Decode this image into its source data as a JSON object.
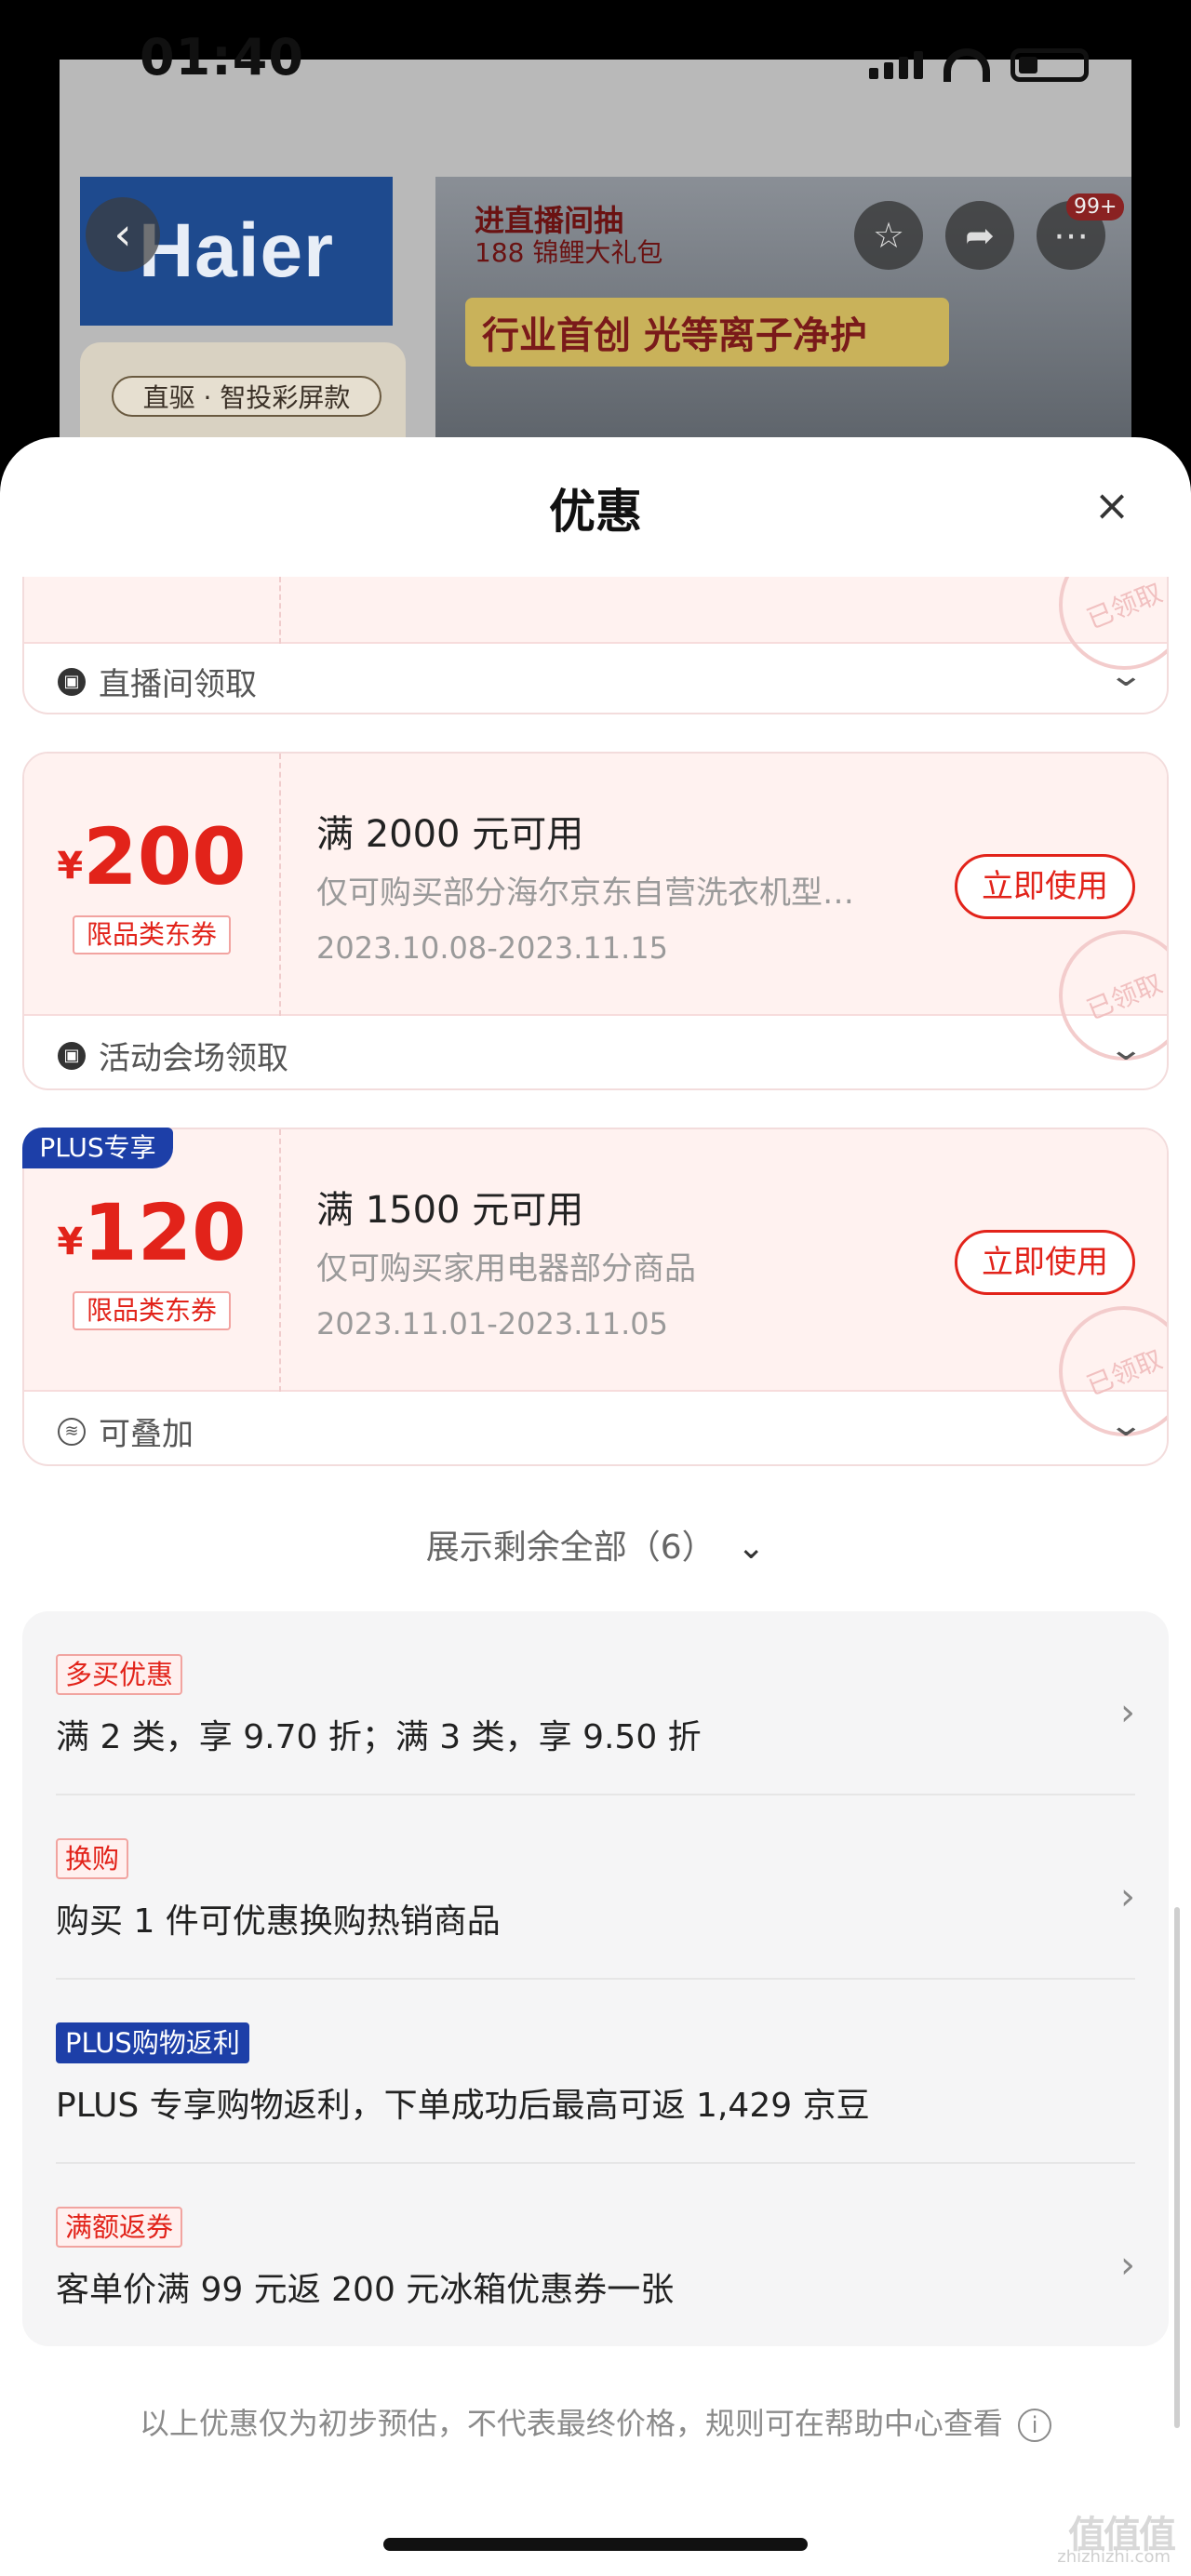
{
  "status_bar": {
    "time": "01:40"
  },
  "background_page": {
    "brand_logo": "Haier",
    "chip": "直驱 · 智投彩屏款",
    "live_line1": "进直播间抽",
    "live_line2": "188 锦鲤大礼包",
    "banner": "行业首创 光等离子净护",
    "cart_badge": "99+"
  },
  "sheet": {
    "title": "优惠",
    "close_icon": "close-icon"
  },
  "coupons": [
    {
      "footer": "直播间领取",
      "stamp": "已领取"
    },
    {
      "currency": "¥",
      "amount": "200",
      "type": "限品类东券",
      "title": "满 2000 元可用",
      "desc": "仅可购买部分海尔京东自营洗衣机型…",
      "date": "2023.10.08-2023.11.15",
      "button": "立即使用",
      "stamp": "已领取",
      "footer": "活动会场领取"
    },
    {
      "badge": "PLUS专享",
      "currency": "¥",
      "amount": "120",
      "type": "限品类东券",
      "title": "满 1500 元可用",
      "desc": "仅可购买家用电器部分商品",
      "date": "2023.11.01-2023.11.05",
      "button": "立即使用",
      "stamp": "已领取",
      "footer": "可叠加"
    }
  ],
  "show_more": "展示剩余全部（6）",
  "promotions": [
    {
      "tag": "多买优惠",
      "text": "满 2 类，享 9.70 折；满 3 类，享 9.50 折",
      "arrow": "›"
    },
    {
      "tag": "换购",
      "text": "购买 1 件可优惠换购热销商品",
      "arrow": "›"
    },
    {
      "tag": "PLUS购物返利",
      "text": "PLUS 专享购物返利，下单成功后最高可返 1,429 京豆",
      "arrow": ""
    },
    {
      "tag": "满额返券",
      "text": "客单价满 99 元返 200 元冰箱优惠券一张",
      "arrow": "›"
    }
  ],
  "disclaimer": "以上优惠仅为初步预估，不代表最终价格，规则可在帮助中心查看",
  "watermark": "值值值",
  "watermark_url": "zhizhizhi.com",
  "colors": {
    "accent_red": "#e2231a",
    "plus_blue": "#1d3fa8",
    "coupon_bg": "#fff2f0"
  }
}
